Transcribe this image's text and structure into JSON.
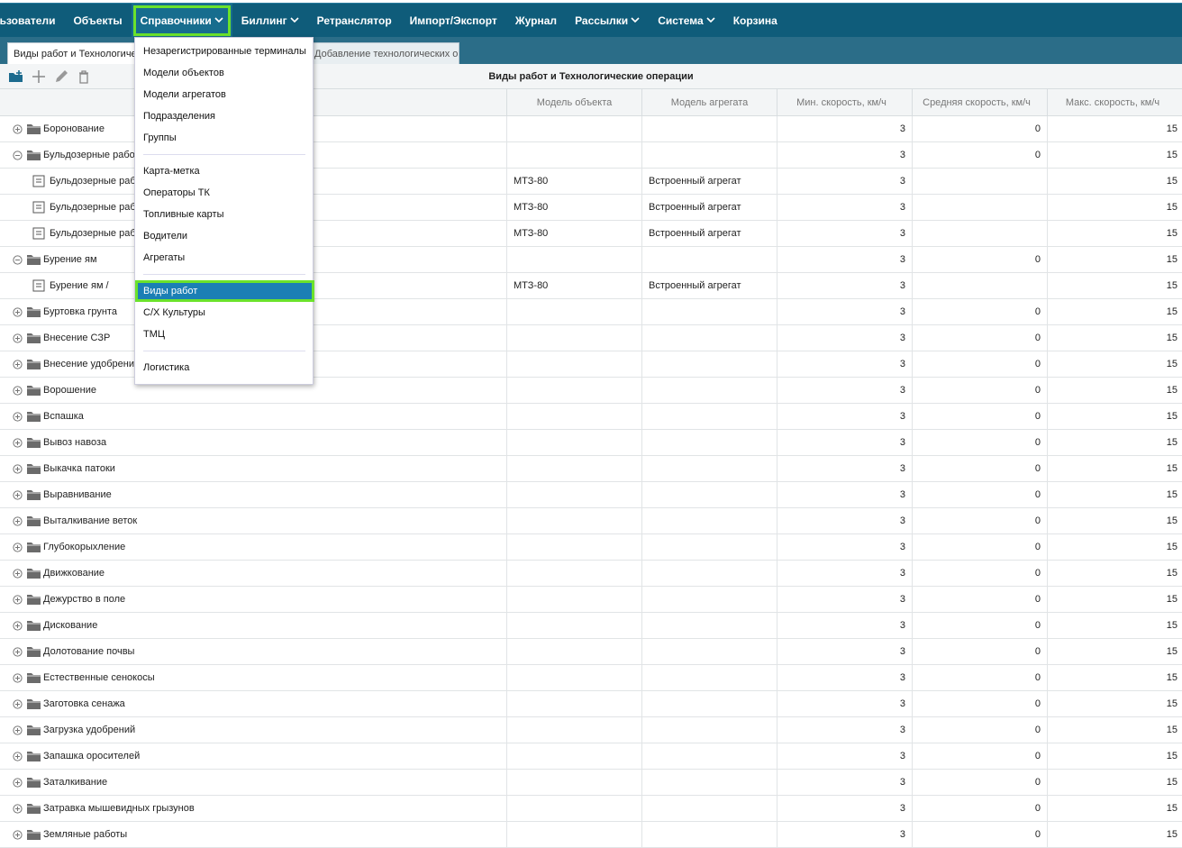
{
  "nav": [
    {
      "label": "льзователи",
      "dropdown": false
    },
    {
      "label": "Объекты",
      "dropdown": false
    },
    {
      "label": "Справочники",
      "dropdown": true,
      "active": true
    },
    {
      "label": "Биллинг",
      "dropdown": true
    },
    {
      "label": "Ретранслятор",
      "dropdown": false
    },
    {
      "label": "Импорт/Экспорт",
      "dropdown": false
    },
    {
      "label": "Журнал",
      "dropdown": false
    },
    {
      "label": "Рассылки",
      "dropdown": true
    },
    {
      "label": "Система",
      "dropdown": true
    },
    {
      "label": "Корзина",
      "dropdown": false
    }
  ],
  "tabs": {
    "active": "Виды работ и Технологические операции",
    "inactive": "Добавление технологических операций"
  },
  "toolbar": {
    "title": "Виды работ и Технологические операции"
  },
  "menu": {
    "groups": [
      [
        "Незарегистрированные терминалы",
        "Модели объектов",
        "Модели агрегатов",
        "Подразделения",
        "Группы"
      ],
      [
        "Карта-метка",
        "Операторы ТК",
        "Топливные карты",
        "Водители",
        "Агрегаты"
      ],
      [
        "Виды работ",
        "С/Х Культуры",
        "ТМЦ"
      ],
      [
        "Логистика"
      ]
    ],
    "selected": "Виды работ"
  },
  "grid": {
    "headers": [
      "",
      "Модель объекта",
      "Модель агрегата",
      "Мин. скорость, км/ч",
      "Средняя скорость, км/ч",
      "Макс. скорость, км/ч"
    ],
    "rows": [
      {
        "type": "group",
        "state": "collapsed",
        "name": "Боронование",
        "model": "",
        "agg": "",
        "min": "3",
        "avg": "0",
        "max": "15"
      },
      {
        "type": "group",
        "state": "expanded",
        "name": "Бульдозерные работы",
        "model": "",
        "agg": "",
        "min": "3",
        "avg": "0",
        "max": "15"
      },
      {
        "type": "leaf",
        "name": "Бульдозерные работы",
        "model": "МТЗ-80",
        "agg": "Встроенный агрегат",
        "min": "3",
        "avg": "",
        "max": "15"
      },
      {
        "type": "leaf",
        "name": "Бульдозерные работы",
        "model": "МТЗ-80",
        "agg": "Встроенный агрегат",
        "min": "3",
        "avg": "",
        "max": "15"
      },
      {
        "type": "leaf",
        "name": "Бульдозерные работы",
        "model": "МТЗ-80",
        "agg": "Встроенный агрегат",
        "min": "3",
        "avg": "",
        "max": "15"
      },
      {
        "type": "group",
        "state": "expanded",
        "name": "Бурение ям",
        "model": "",
        "agg": "",
        "min": "3",
        "avg": "0",
        "max": "15"
      },
      {
        "type": "leaf",
        "name": "Бурение ям /",
        "model": "МТЗ-80",
        "agg": "Встроенный агрегат",
        "min": "3",
        "avg": "",
        "max": "15"
      },
      {
        "type": "group",
        "state": "collapsed",
        "name": "Буртовка грунта",
        "model": "",
        "agg": "",
        "min": "3",
        "avg": "0",
        "max": "15"
      },
      {
        "type": "group",
        "state": "collapsed",
        "name": "Внесение СЗР",
        "model": "",
        "agg": "",
        "min": "3",
        "avg": "0",
        "max": "15"
      },
      {
        "type": "group",
        "state": "collapsed",
        "name": "Внесение удобрений",
        "model": "",
        "agg": "",
        "min": "3",
        "avg": "0",
        "max": "15"
      },
      {
        "type": "group",
        "state": "collapsed",
        "name": "Ворошение",
        "model": "",
        "agg": "",
        "min": "3",
        "avg": "0",
        "max": "15"
      },
      {
        "type": "group",
        "state": "collapsed",
        "name": "Вспашка",
        "model": "",
        "agg": "",
        "min": "3",
        "avg": "0",
        "max": "15"
      },
      {
        "type": "group",
        "state": "collapsed",
        "name": "Вывоз навоза",
        "model": "",
        "agg": "",
        "min": "3",
        "avg": "0",
        "max": "15"
      },
      {
        "type": "group",
        "state": "collapsed",
        "name": "Выкачка патоки",
        "model": "",
        "agg": "",
        "min": "3",
        "avg": "0",
        "max": "15"
      },
      {
        "type": "group",
        "state": "collapsed",
        "name": "Выравнивание",
        "model": "",
        "agg": "",
        "min": "3",
        "avg": "0",
        "max": "15"
      },
      {
        "type": "group",
        "state": "collapsed",
        "name": "Выталкивание веток",
        "model": "",
        "agg": "",
        "min": "3",
        "avg": "0",
        "max": "15"
      },
      {
        "type": "group",
        "state": "collapsed",
        "name": "Глубокорыхление",
        "model": "",
        "agg": "",
        "min": "3",
        "avg": "0",
        "max": "15"
      },
      {
        "type": "group",
        "state": "collapsed",
        "name": "Движкование",
        "model": "",
        "agg": "",
        "min": "3",
        "avg": "0",
        "max": "15"
      },
      {
        "type": "group",
        "state": "collapsed",
        "name": "Дежурство в поле",
        "model": "",
        "agg": "",
        "min": "3",
        "avg": "0",
        "max": "15"
      },
      {
        "type": "group",
        "state": "collapsed",
        "name": "Дискование",
        "model": "",
        "agg": "",
        "min": "3",
        "avg": "0",
        "max": "15"
      },
      {
        "type": "group",
        "state": "collapsed",
        "name": "Долотование почвы",
        "model": "",
        "agg": "",
        "min": "3",
        "avg": "0",
        "max": "15"
      },
      {
        "type": "group",
        "state": "collapsed",
        "name": "Естественные сенокосы",
        "model": "",
        "agg": "",
        "min": "3",
        "avg": "0",
        "max": "15"
      },
      {
        "type": "group",
        "state": "collapsed",
        "name": "Заготовка сенажа",
        "model": "",
        "agg": "",
        "min": "3",
        "avg": "0",
        "max": "15"
      },
      {
        "type": "group",
        "state": "collapsed",
        "name": "Загрузка удобрений",
        "model": "",
        "agg": "",
        "min": "3",
        "avg": "0",
        "max": "15"
      },
      {
        "type": "group",
        "state": "collapsed",
        "name": "Запашка оросителей",
        "model": "",
        "agg": "",
        "min": "3",
        "avg": "0",
        "max": "15"
      },
      {
        "type": "group",
        "state": "collapsed",
        "name": "Заталкивание",
        "model": "",
        "agg": "",
        "min": "3",
        "avg": "0",
        "max": "15"
      },
      {
        "type": "group",
        "state": "collapsed",
        "name": "Затравка мышевидных грызунов",
        "model": "",
        "agg": "",
        "min": "3",
        "avg": "0",
        "max": "15"
      },
      {
        "type": "group",
        "state": "collapsed",
        "name": "Земляные работы",
        "model": "",
        "agg": "",
        "min": "3",
        "avg": "0",
        "max": "15"
      }
    ]
  },
  "icons": {
    "toolbar": [
      "add-folder-icon",
      "plus-icon",
      "pencil-icon",
      "trash-icon"
    ],
    "tree": [
      "expand-plus-icon",
      "collapse-minus-icon",
      "folder-icon",
      "document-icon"
    ]
  },
  "colors": {
    "nav_bg": "#0f5c7a",
    "highlight": "#6be22b",
    "selected_item": "#1b7fb5"
  }
}
